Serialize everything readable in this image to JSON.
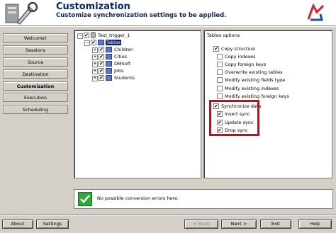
{
  "header": {
    "title": "Customization",
    "subtitle": "Customize synchronization settings to be applied."
  },
  "nav": [
    {
      "label": "Welcome!",
      "active": false
    },
    {
      "label": "Sessions",
      "active": false
    },
    {
      "label": "Source",
      "active": false
    },
    {
      "label": "Destination",
      "active": false
    },
    {
      "label": "Customization",
      "active": true
    },
    {
      "label": "Execution",
      "active": false
    },
    {
      "label": "Scheduling",
      "active": false
    }
  ],
  "tree": {
    "root": "Test_trigger_1",
    "tables_node": "Tables",
    "children": [
      "Children",
      "Cities",
      "DMSoft",
      "Jobs",
      "Students"
    ]
  },
  "options": {
    "group_title": "Tables options",
    "items": [
      {
        "label": "Copy structure",
        "checked": true
      },
      {
        "label": "Copy indexes",
        "checked": false
      },
      {
        "label": "Copy foreign keys",
        "checked": false
      },
      {
        "label": "Overwrite existing tables",
        "checked": false
      },
      {
        "label": "Modify existing fields type",
        "checked": false
      },
      {
        "label": "Modify existing indexes",
        "checked": false
      },
      {
        "label": "Modify existing foreign keys",
        "checked": false
      }
    ],
    "sync": {
      "label": "Synchronize data",
      "checked": true
    },
    "sync_items": [
      {
        "label": "Insert sync",
        "checked": true
      },
      {
        "label": "Update sync",
        "checked": true
      },
      {
        "label": "Drop sync",
        "checked": true
      }
    ],
    "highlight_color": "#e00010"
  },
  "message": {
    "text": "No possible conversion errors here."
  },
  "buttons": {
    "about": "About",
    "settings": "Settings",
    "back": "< Back",
    "next": "Next >",
    "exit": "Exit",
    "help": "Help"
  }
}
